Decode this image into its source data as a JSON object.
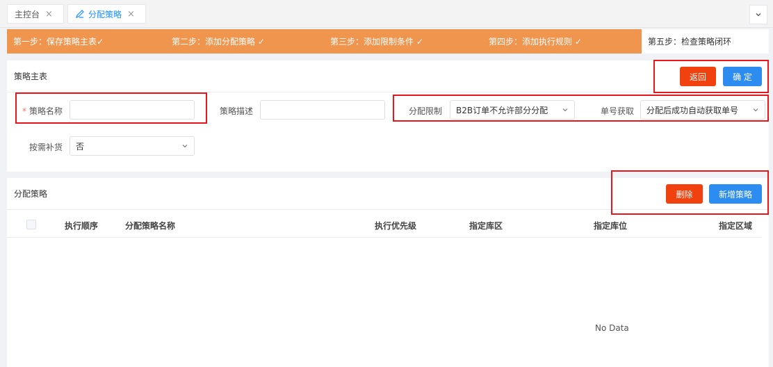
{
  "tabs": [
    {
      "label": "主控台",
      "close": "×"
    },
    {
      "label": "分配策略",
      "close": "×"
    }
  ],
  "steps": [
    "第一步：保存策略主表✓",
    "第二步：添加分配策略 ✓",
    "第三步：添加限制条件 ✓",
    "第四步：添加执行规则 ✓",
    "第五步：检查策略闭环"
  ],
  "master": {
    "title": "策略主表",
    "back_label": "返回",
    "confirm_label": "确 定",
    "required_mark": "*",
    "name_label": "策略名称",
    "name_value": "",
    "desc_label": "策略描述",
    "desc_value": "",
    "limit_label": "分配限制",
    "limit_value": "B2B订单不允许部分分配",
    "order_label": "单号获取",
    "order_value": "分配后成功自动获取单号",
    "replenish_label": "按需补货",
    "replenish_value": "否"
  },
  "alloc": {
    "title": "分配策略",
    "delete_label": "删除",
    "add_label": "新增策略",
    "columns": [
      "执行顺序",
      "分配策略名称",
      "执行优先级",
      "指定库区",
      "指定库位",
      "指定区域"
    ],
    "empty_text": "No Data"
  },
  "colors": {
    "step_done": "#f0954e",
    "danger": "#f0410e",
    "primary": "#2d8cf0",
    "highlight": "#e8161b"
  }
}
